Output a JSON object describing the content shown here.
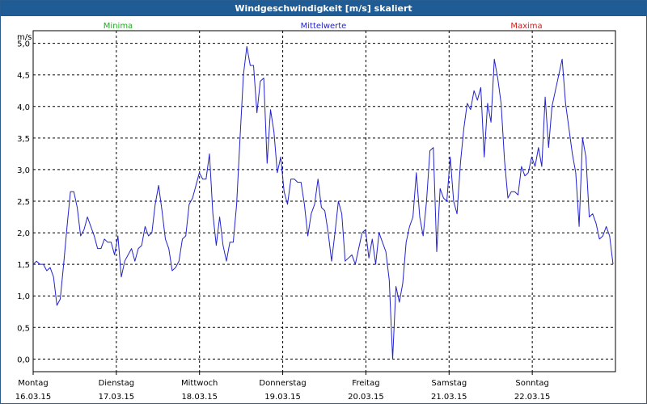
{
  "window": {
    "title": "Windgeschwindigkeit [m/s] skaliert"
  },
  "legend": [
    {
      "label": "Minima",
      "color": "#22aa22"
    },
    {
      "label": "Mittelwerte",
      "color": "#2222cc"
    },
    {
      "label": "Maxima",
      "color": "#cc2222"
    }
  ],
  "chart_data": {
    "type": "line",
    "title": "Windgeschwindigkeit [m/s] skaliert",
    "ylabel": "m/s",
    "xlabel": "",
    "ylim": [
      -0.2,
      5.2
    ],
    "yticks": [
      "0,0",
      "0,5",
      "1,0",
      "1,5",
      "2,0",
      "2,5",
      "3,0",
      "3,5",
      "4,0",
      "4,5",
      "5,0"
    ],
    "ytick_values": [
      0,
      0.5,
      1,
      1.5,
      2,
      2.5,
      3,
      3.5,
      4,
      4.5,
      5
    ],
    "xticks": [
      {
        "day": "Montag",
        "date": "16.03.15"
      },
      {
        "day": "Dienstag",
        "date": "17.03.15"
      },
      {
        "day": "Mittwoch",
        "date": "18.03.15"
      },
      {
        "day": "Donnerstag",
        "date": "19.03.15"
      },
      {
        "day": "Freitag",
        "date": "20.03.15"
      },
      {
        "day": "Samstag",
        "date": "21.03.15"
      },
      {
        "day": "Sonntag",
        "date": "22.03.15"
      }
    ],
    "grid": true,
    "series": [
      {
        "name": "Mittelwerte",
        "color": "#2222cc",
        "values": [
          1.5,
          1.55,
          1.5,
          1.5,
          1.4,
          1.45,
          1.3,
          0.85,
          0.95,
          1.5,
          2.1,
          2.65,
          2.65,
          2.4,
          1.95,
          2.05,
          2.25,
          2.1,
          1.95,
          1.75,
          1.75,
          1.9,
          1.85,
          1.85,
          1.65,
          1.95,
          1.3,
          1.55,
          1.65,
          1.75,
          1.55,
          1.75,
          1.8,
          2.1,
          1.95,
          2.0,
          2.45,
          2.75,
          2.35,
          1.9,
          1.75,
          1.4,
          1.45,
          1.55,
          1.9,
          1.95,
          2.45,
          2.55,
          2.75,
          2.95,
          2.85,
          2.85,
          3.25,
          2.3,
          1.8,
          2.25,
          1.8,
          1.55,
          1.85,
          1.85,
          2.45,
          3.5,
          4.5,
          4.95,
          4.65,
          4.65,
          3.9,
          4.4,
          4.45,
          3.1,
          3.95,
          3.6,
          2.95,
          3.2,
          2.65,
          2.45,
          2.85,
          2.85,
          2.8,
          2.8,
          2.45,
          1.95,
          2.3,
          2.45,
          2.85,
          2.4,
          2.35,
          2.0,
          1.55,
          2.0,
          2.5,
          2.3,
          1.55,
          1.6,
          1.65,
          1.5,
          1.75,
          2.0,
          2.05,
          1.6,
          1.9,
          1.5,
          2.0,
          1.85,
          1.7,
          1.25,
          0.0,
          1.15,
          0.9,
          1.2,
          1.85,
          2.1,
          2.25,
          2.95,
          2.25,
          1.95,
          2.5,
          3.3,
          3.35,
          1.7,
          2.7,
          2.55,
          2.5,
          3.2,
          2.5,
          2.3,
          3.1,
          3.65,
          4.05,
          3.95,
          4.25,
          4.1,
          4.3,
          3.2,
          4.05,
          3.75,
          4.75,
          4.45,
          4.05,
          3.15,
          2.55,
          2.65,
          2.65,
          2.6,
          3.05,
          2.9,
          2.95,
          3.2,
          3.05,
          3.35,
          3.05,
          4.15,
          3.35,
          4.0,
          4.25,
          4.5,
          4.75,
          4.05,
          3.65,
          3.25,
          2.95,
          2.1,
          3.5,
          3.2,
          2.25,
          2.3,
          2.15,
          1.9,
          1.95,
          2.1,
          1.95,
          1.5
        ]
      }
    ]
  }
}
